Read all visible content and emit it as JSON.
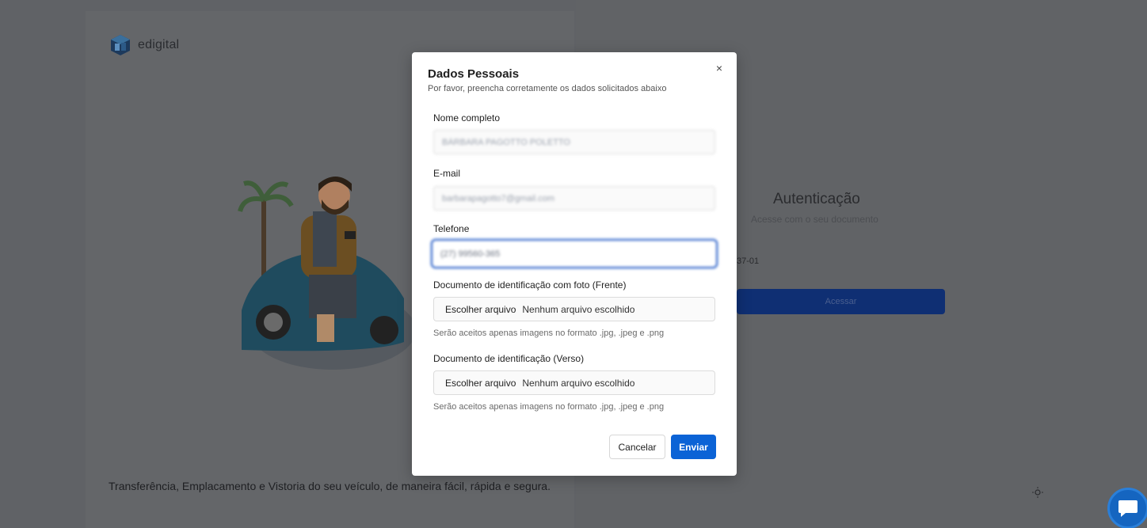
{
  "background": {
    "brand_name": "edigital",
    "tagline": "Transferência, Emplacamento e Vistoria do seu veículo, de maneira fácil, rápida e segura.",
    "auth_title": "Autenticação",
    "auth_subtitle": "Acesse com o seu documento",
    "auth_document_partial": "37-01",
    "auth_button_label": "Acessar"
  },
  "modal": {
    "title": "Dados Pessoais",
    "subtitle": "Por favor, preencha corretamente os dados solicitados abaixo",
    "close_label": "×",
    "fields": {
      "name": {
        "label": "Nome completo",
        "value": "BÁRBARA PAGOTTO POLETTO"
      },
      "email": {
        "label": "E-mail",
        "value": "barbarapagotto7@gmail.com"
      },
      "phone": {
        "label": "Telefone",
        "value": "(27) 99560-365"
      }
    },
    "doc_front": {
      "label": "Documento de identificação com foto (Frente)",
      "button": "Escolher arquivo",
      "status": "Nenhum arquivo escolhido",
      "hint": "Serão aceitos apenas imagens no formato .jpg, .jpeg e .png"
    },
    "doc_back": {
      "label": "Documento de identificação (Verso)",
      "button": "Escolher arquivo",
      "status": "Nenhum arquivo escolhido",
      "hint": "Serão aceitos apenas imagens no formato .jpg, .jpeg e .png"
    },
    "cancel_label": "Cancelar",
    "submit_label": "Enviar"
  },
  "colors": {
    "primary": "#0b63d6",
    "focus_border": "#2f64c8",
    "overlay": "#606266"
  },
  "icons": {
    "brand": "edigital-logo-icon",
    "close": "close-icon",
    "theme": "sun-icon",
    "chat": "chat-bubble-icon"
  }
}
